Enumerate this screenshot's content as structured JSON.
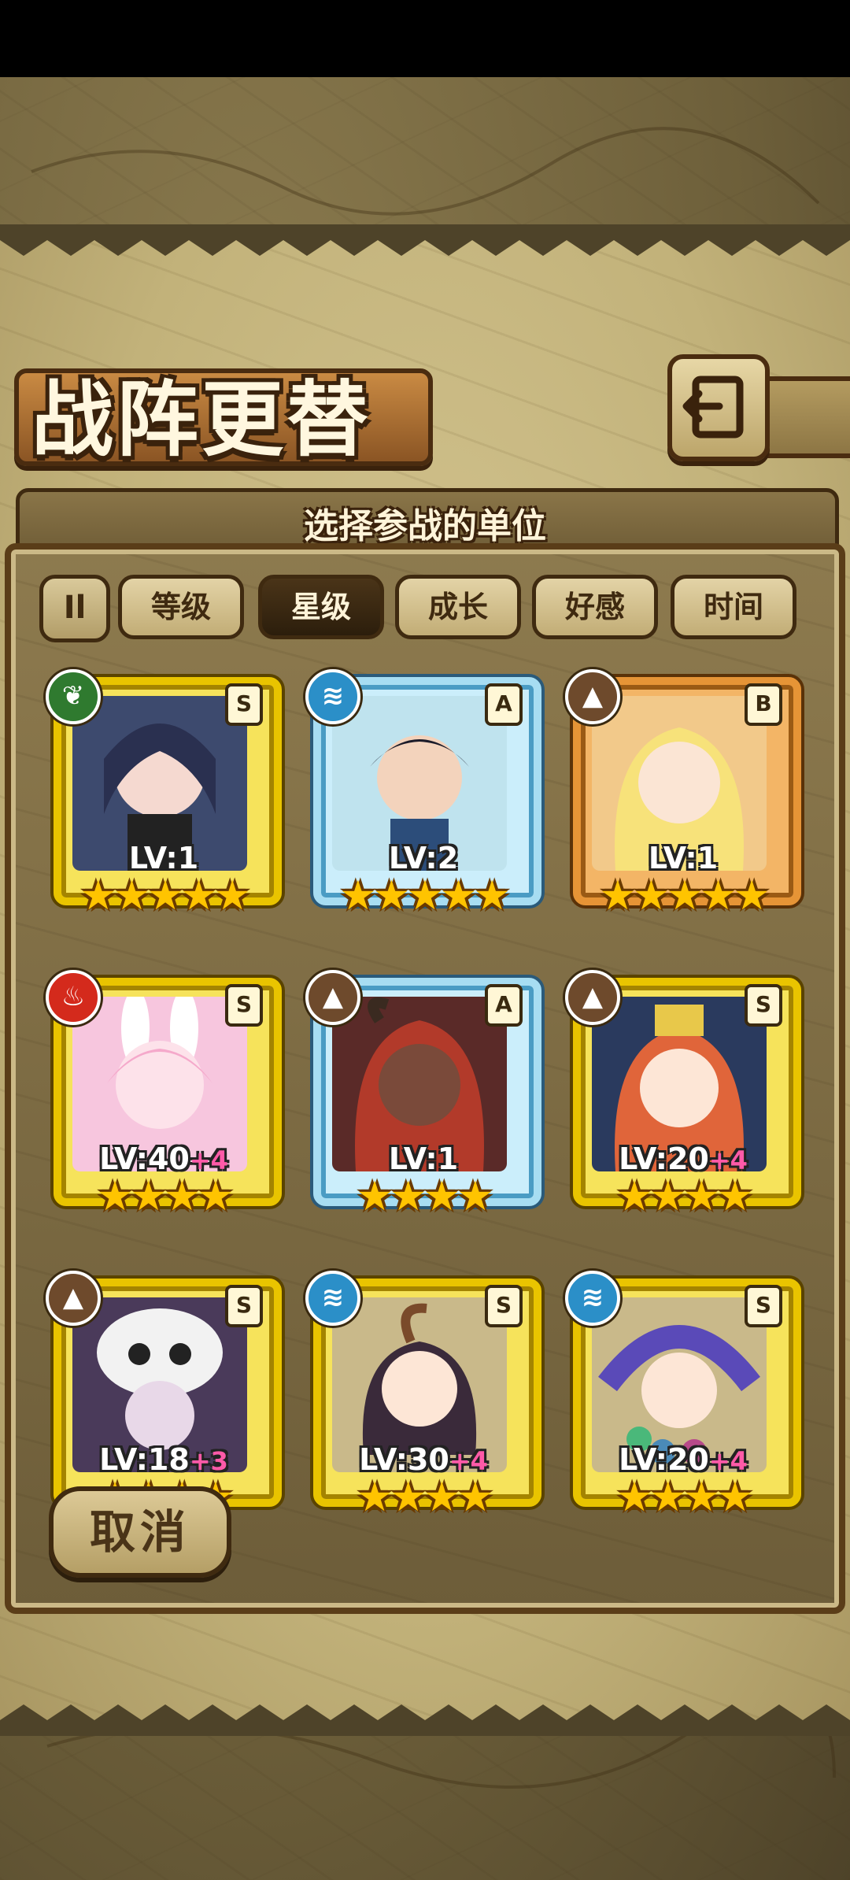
{
  "header": {
    "title": "战阵更替",
    "subtitle": "选择参战的单位"
  },
  "sort": {
    "toggle_label": "Il",
    "tabs": [
      {
        "label": "等级",
        "active": false
      },
      {
        "label": "星级",
        "active": true
      },
      {
        "label": "成长",
        "active": false
      },
      {
        "label": "好感",
        "active": false
      },
      {
        "label": "时间",
        "active": false
      }
    ]
  },
  "units": [
    {
      "level": "LV:1",
      "bonus": "",
      "rank": "S",
      "element": "wind-icon",
      "frame": "gold",
      "stars": "★★★★★"
    },
    {
      "level": "LV:2",
      "bonus": "",
      "rank": "A",
      "element": "water-icon",
      "frame": "blue",
      "stars": "★★★★★"
    },
    {
      "level": "LV:1",
      "bonus": "",
      "rank": "B",
      "element": "earth-icon",
      "frame": "orange",
      "stars": "★★★★★"
    },
    {
      "level": "LV:40",
      "bonus": "+4",
      "rank": "S",
      "element": "fire-icon",
      "frame": "gold",
      "stars": "★★★★"
    },
    {
      "level": "LV:1",
      "bonus": "",
      "rank": "A",
      "element": "earth-icon",
      "frame": "blue",
      "stars": "★★★★"
    },
    {
      "level": "LV:20",
      "bonus": "+4",
      "rank": "S",
      "element": "earth-icon",
      "frame": "gold",
      "stars": "★★★★"
    },
    {
      "level": "LV:18",
      "bonus": "+3",
      "rank": "S",
      "element": "earth-icon",
      "frame": "gold",
      "stars": "★★★★"
    },
    {
      "level": "LV:30",
      "bonus": "+4",
      "rank": "S",
      "element": "water-icon",
      "frame": "gold",
      "stars": "★★★★"
    },
    {
      "level": "LV:20",
      "bonus": "+4",
      "rank": "S",
      "element": "water-icon",
      "frame": "gold",
      "stars": "★★★★"
    }
  ],
  "footer": {
    "cancel_label": "取消"
  },
  "colors": {
    "wind": "#2f7a2f",
    "water": "#2b8fc8",
    "earth": "#6e4a2c",
    "fire": "#d42a1c"
  }
}
